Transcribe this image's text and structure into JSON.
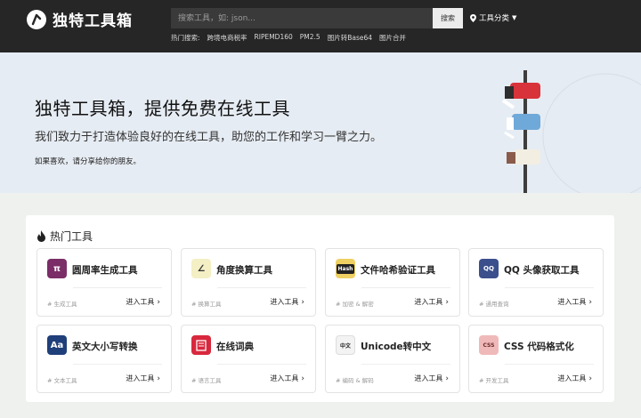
{
  "header": {
    "logo_text": "独特工具箱",
    "search_placeholder": "搜索工具，如: json...",
    "search_button": "搜索",
    "category_label": "工具分类",
    "hot_label": "热门搜索:",
    "hot_items": [
      "跨境电商税率",
      "RIPEMD160",
      "PM2.5",
      "图片转Base64",
      "图片合并"
    ]
  },
  "hero": {
    "title": "独特工具箱，提供免费在线工具",
    "subtitle": "我们致力于打造体验良好的在线工具，助您的工作和学习一臂之力。",
    "note": "如果喜欢，请分享给你的朋友。"
  },
  "panel": {
    "title": "热门工具"
  },
  "tools": [
    {
      "name": "圆周率生成工具",
      "tag": "# 生成工具",
      "enter": "进入工具",
      "icon": "π",
      "icon_name": "pi-icon",
      "color": "#7b2d68"
    },
    {
      "name": "角度换算工具",
      "tag": "# 换算工具",
      "enter": "进入工具",
      "icon": "∠",
      "icon_name": "angle-icon",
      "color": "#f4efc4"
    },
    {
      "name": "文件哈希验证工具",
      "tag": "# 加密 & 解密",
      "enter": "进入工具",
      "icon": "Hash",
      "icon_name": "hash-icon",
      "color": "#efd062"
    },
    {
      "name": "QQ 头像获取工具",
      "tag": "# 通用查询",
      "enter": "进入工具",
      "icon": "QQ",
      "icon_name": "qq-icon",
      "color": "#3b4f8c"
    },
    {
      "name": "英文大小写转换",
      "tag": "# 文本工具",
      "enter": "进入工具",
      "icon": "Aa",
      "icon_name": "case-icon",
      "color": "#1f3f7a"
    },
    {
      "name": "在线词典",
      "tag": "# 语言工具",
      "enter": "进入工具",
      "icon": "D",
      "icon_name": "dictionary-icon",
      "color": "#d8283d"
    },
    {
      "name": "Unicode转中文",
      "tag": "# 编码 & 解码",
      "enter": "进入工具",
      "icon": "中文",
      "icon_name": "unicode-icon",
      "color": "#f3f3f3"
    },
    {
      "name": "CSS 代码格式化",
      "tag": "# 开发工具",
      "enter": "进入工具",
      "icon": "CSS",
      "icon_name": "css-icon",
      "color": "#f0b9b9"
    }
  ]
}
